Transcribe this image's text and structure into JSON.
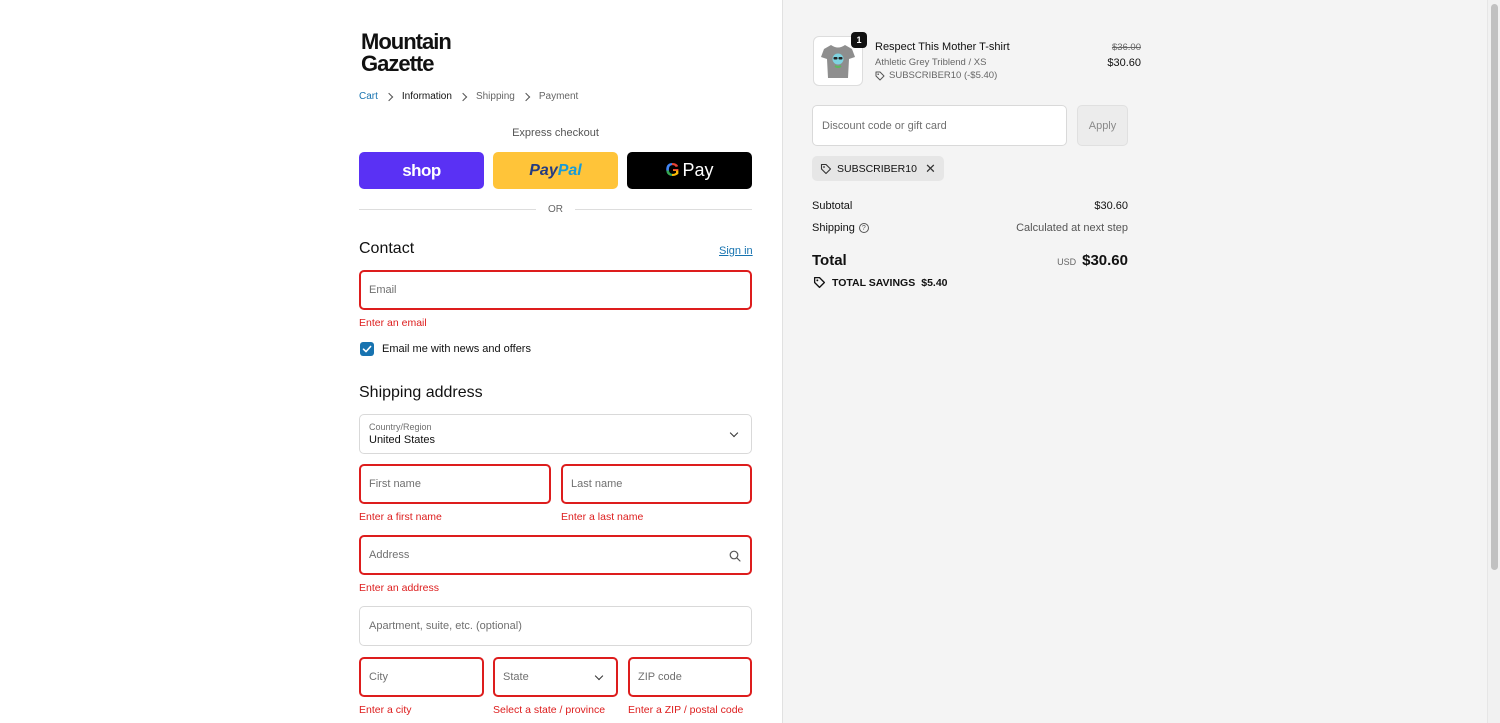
{
  "brand": {
    "line1": "Mountain",
    "line2": "Gazette"
  },
  "breadcrumbs": [
    "Cart",
    "Information",
    "Shipping",
    "Payment"
  ],
  "express": {
    "label": "Express checkout",
    "shop": "shop",
    "paypal_a": "Pay",
    "paypal_b": "Pal",
    "gpay_g": "G",
    "gpay_text": "Pay",
    "or": "OR"
  },
  "contact": {
    "heading": "Contact",
    "sign_in": "Sign in",
    "email_placeholder": "Email",
    "email_error": "Enter an email",
    "newsletter_label": "Email me with news and offers",
    "newsletter_checked": true
  },
  "shipping": {
    "heading": "Shipping address",
    "country_label": "Country/Region",
    "country_value": "United States",
    "first_name": "First name",
    "first_name_error": "Enter a first name",
    "last_name": "Last name",
    "last_name_error": "Enter a last name",
    "address": "Address",
    "address_error": "Enter an address",
    "apartment": "Apartment, suite, etc. (optional)",
    "city": "City",
    "city_error": "Enter a city",
    "state": "State",
    "state_error": "Select a state / province",
    "zip": "ZIP code",
    "zip_error": "Enter a ZIP / postal code"
  },
  "order": {
    "item": {
      "name": "Respect This Mother T-shirt",
      "variant": "Athletic Grey Triblend / XS",
      "discount": "SUBSCRIBER10 (-$5.40)",
      "quantity": "1",
      "original_price": "$36.00",
      "price": "$30.60"
    },
    "discount_placeholder": "Discount code or gift card",
    "apply": "Apply",
    "applied_code": "SUBSCRIBER10",
    "subtotal_label": "Subtotal",
    "subtotal": "$30.60",
    "shipping_label": "Shipping",
    "shipping_value": "Calculated at next step",
    "total_label": "Total",
    "currency": "USD",
    "total": "$30.60",
    "savings_label": "TOTAL SAVINGS",
    "savings": "$5.40"
  },
  "colors": {
    "accent": "#1773b0",
    "error": "#dd1d1d",
    "shop": "#5a31f4",
    "paypal": "#ffc439"
  }
}
